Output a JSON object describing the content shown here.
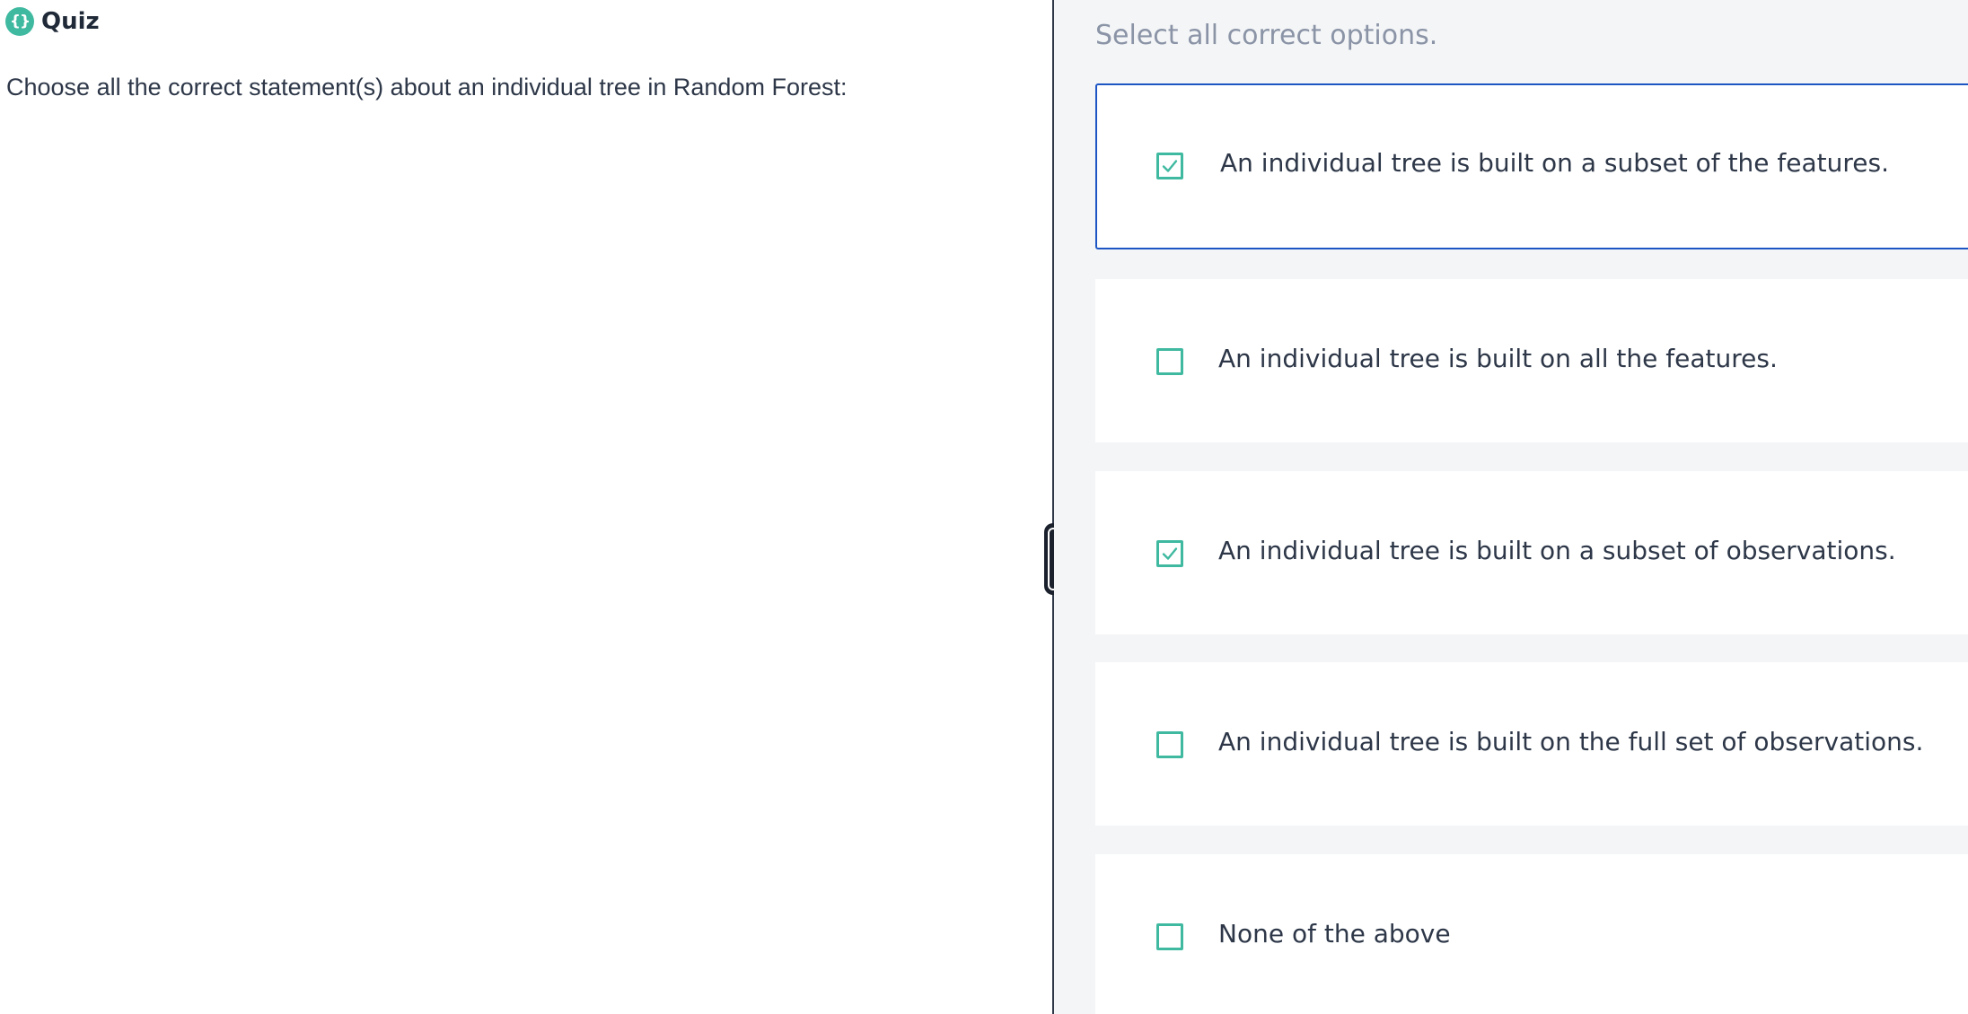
{
  "quiz": {
    "icon": "curly-braces-icon",
    "icon_glyph": "{}",
    "title": "Quiz",
    "question": "Choose all the correct statement(s) about an individual tree in Random Forest:"
  },
  "answers": {
    "instruction": "Select all correct options.",
    "options": [
      {
        "label": "An individual tree is built on a subset of the features.",
        "checked": true,
        "focused": true
      },
      {
        "label": "An individual tree is built on all the features.",
        "checked": false
      },
      {
        "label": "An individual tree is built on a subset of observations.",
        "checked": true
      },
      {
        "label": "An individual tree is built on the full set of observations.",
        "checked": false
      },
      {
        "label": "None of the above",
        "checked": false
      }
    ]
  },
  "colors": {
    "accent": "#3fb9a0",
    "focus_border": "#1d56c4",
    "text": "#2d3748",
    "muted_text": "#8a94a6",
    "pane_background": "#f4f5f7"
  }
}
